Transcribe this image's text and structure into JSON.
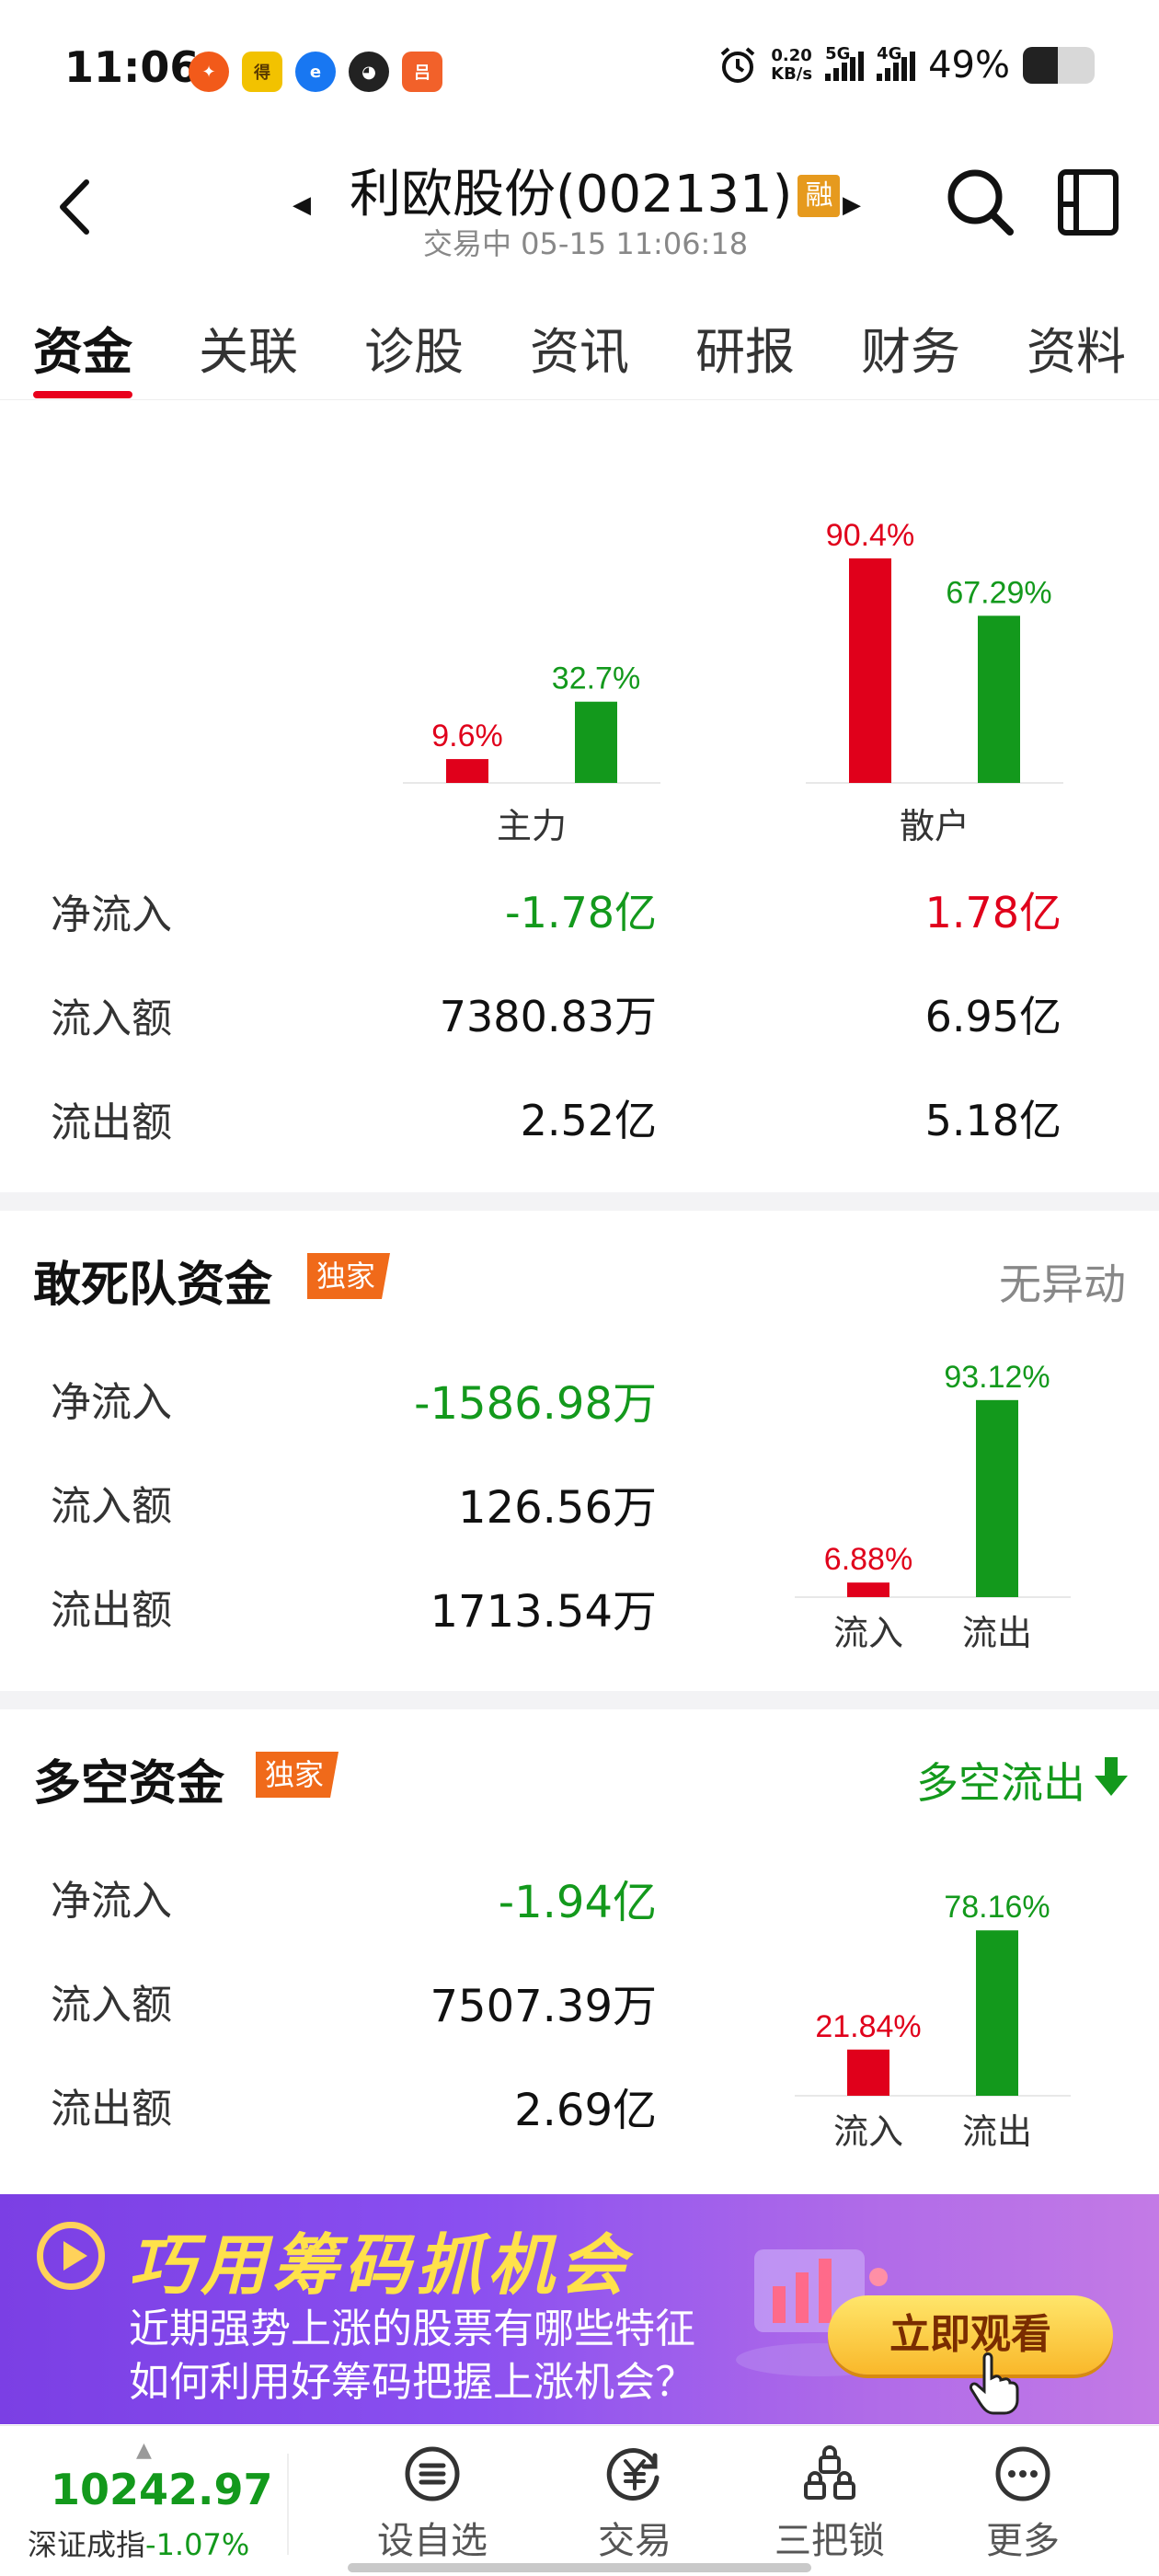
{
  "status_bar": {
    "time": "11:06",
    "net_speed": "0.20",
    "net_unit": "KB/s",
    "sim1": "5G",
    "sim2": "4G",
    "battery": "49%",
    "battery_level": 0.49
  },
  "header": {
    "stock_name": "利欧股份(002131)",
    "margin_badge": "融",
    "status": "交易中 05-15 11:06:18"
  },
  "tabs": [
    {
      "label": "资金",
      "active": true
    },
    {
      "label": "关联",
      "active": false
    },
    {
      "label": "诊股",
      "active": false
    },
    {
      "label": "资讯",
      "active": false
    },
    {
      "label": "研报",
      "active": false
    },
    {
      "label": "财务",
      "active": false
    },
    {
      "label": "资料",
      "active": false
    }
  ],
  "comparison": {
    "chart_data": {
      "type": "bar",
      "categories": [
        "主力",
        "散户"
      ],
      "series": [
        {
          "values": [
            9.6,
            90.4
          ],
          "color": "#e0001b",
          "labels": [
            "9.6%",
            "90.4%"
          ]
        },
        {
          "values": [
            32.7,
            67.29
          ],
          "color": "#13991c",
          "labels": [
            "32.7%",
            "67.29%"
          ]
        }
      ]
    },
    "rows": [
      {
        "name": "净流入",
        "main": "-1.78亿",
        "main_color": "green",
        "retail": "1.78亿",
        "retail_color": "red"
      },
      {
        "name": "流入额",
        "main": "7380.83万",
        "main_color": "",
        "retail": "6.95亿",
        "retail_color": ""
      },
      {
        "name": "流出额",
        "main": "2.52亿",
        "main_color": "",
        "retail": "5.18亿",
        "retail_color": ""
      }
    ]
  },
  "dare_to_die": {
    "title": "敢死队资金",
    "badge": "独家",
    "status": "无异动",
    "rows": [
      {
        "name": "净流入",
        "value": "-1586.98万",
        "color": "green"
      },
      {
        "name": "流入额",
        "value": "126.56万",
        "color": ""
      },
      {
        "name": "流出额",
        "value": "1713.54万",
        "color": ""
      }
    ],
    "chart_data": {
      "type": "bar",
      "categories": [
        "流入",
        "流出"
      ],
      "values": [
        6.88,
        93.12
      ],
      "labels": [
        "6.88%",
        "93.12%"
      ],
      "colors": [
        "#e0001b",
        "#13991c"
      ]
    }
  },
  "long_short": {
    "title": "多空资金",
    "badge": "独家",
    "status": "多空流出",
    "rows": [
      {
        "name": "净流入",
        "value": "-1.94亿",
        "color": "green"
      },
      {
        "name": "流入额",
        "value": "7507.39万",
        "color": ""
      },
      {
        "name": "流出额",
        "value": "2.69亿",
        "color": ""
      }
    ],
    "chart_data": {
      "type": "bar",
      "categories": [
        "流入",
        "流出"
      ],
      "values": [
        21.84,
        78.16
      ],
      "labels": [
        "21.84%",
        "78.16%"
      ],
      "colors": [
        "#e0001b",
        "#13991c"
      ]
    }
  },
  "banner": {
    "title": "巧用筹码抓机会",
    "line1": "近期强势上涨的股票有哪些特征",
    "line2": "如何利用好筹码把握上涨机会？",
    "button": "立即观看"
  },
  "bottom_bar": {
    "index_value": "10242.97",
    "index_name": "深证成指",
    "index_change": "-1.07%",
    "nav": [
      {
        "label": "设自选",
        "icon": "menu-circle-icon"
      },
      {
        "label": "交易",
        "icon": "yuan-circle-icon"
      },
      {
        "label": "三把锁",
        "icon": "locks-icon"
      },
      {
        "label": "更多",
        "icon": "more-dots-icon"
      }
    ]
  }
}
